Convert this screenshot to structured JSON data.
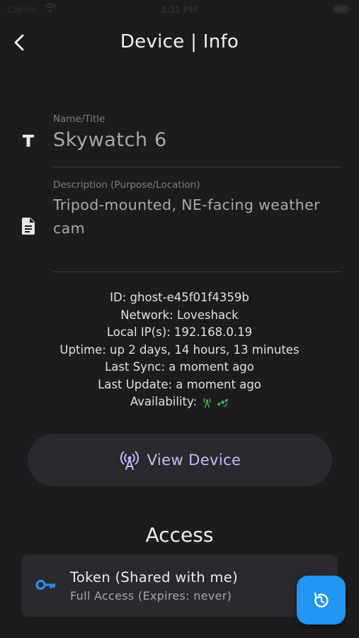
{
  "status_bar": {
    "carrier": "Carrier",
    "time": "3:11 PM"
  },
  "nav": {
    "title": "Device | Info"
  },
  "fields": {
    "name": {
      "label": "Name/Title",
      "value": "Skywatch 6"
    },
    "description": {
      "label": "Description (Purpose/Location)",
      "value": "Tripod-mounted, NE-facing weather cam"
    }
  },
  "info": {
    "id": "ID: ghost-e45f01f4359b",
    "network": "Network: Loveshack",
    "local_ip": "Local IP(s): 192.168.0.19",
    "uptime": "Uptime: up 2 days, 14 hours, 13 minutes",
    "last_sync": "Last Sync: a moment ago",
    "last_update": "Last Update: a moment ago",
    "availability_label": "Availability:",
    "availability_icons": [
      "antenna-icon",
      "satellite-icon"
    ]
  },
  "view_device": {
    "label": "View Device",
    "icon": "wireless-tower-icon"
  },
  "access": {
    "heading": "Access",
    "token": {
      "title": "Token (Shared with me)",
      "subtitle": "Full Access (Expires: never)",
      "icon": "key-icon"
    }
  },
  "fab": {
    "icon": "refresh-icon"
  },
  "colors": {
    "background": "#1c1c1e",
    "card": "#2a2a2e",
    "accent_purple": "#c9b8f7",
    "accent_blue": "#2196f3",
    "availability_green": "#4caf50"
  }
}
